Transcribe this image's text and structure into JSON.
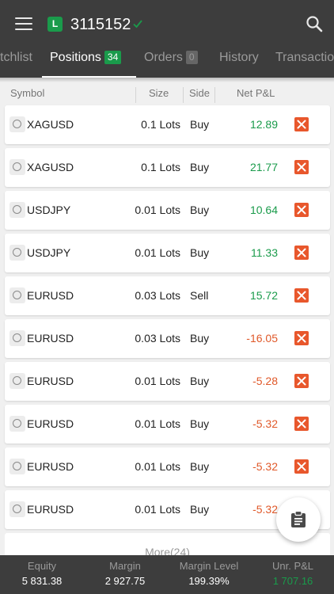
{
  "header": {
    "account_badge": "L",
    "account_number": "3115152"
  },
  "tabs": [
    {
      "label": "Watchlist",
      "visible_label": "tchlist"
    },
    {
      "label": "Positions",
      "count": "34"
    },
    {
      "label": "Orders",
      "count": "0"
    },
    {
      "label": "History"
    },
    {
      "label": "Transactions",
      "visible_label": "Transactio"
    }
  ],
  "columns": {
    "symbol": "Symbol",
    "size": "Size",
    "side": "Side",
    "pnl": "Net P&L"
  },
  "positions": [
    {
      "symbol": "XAGUSD",
      "size": "0.1 Lots",
      "side": "Buy",
      "pnl": "12.89",
      "pnl_sign": "pos"
    },
    {
      "symbol": "XAGUSD",
      "size": "0.1 Lots",
      "side": "Buy",
      "pnl": "21.77",
      "pnl_sign": "pos"
    },
    {
      "symbol": "USDJPY",
      "size": "0.01 Lots",
      "side": "Buy",
      "pnl": "10.64",
      "pnl_sign": "pos"
    },
    {
      "symbol": "USDJPY",
      "size": "0.01 Lots",
      "side": "Buy",
      "pnl": "11.33",
      "pnl_sign": "pos"
    },
    {
      "symbol": "EURUSD",
      "size": "0.03 Lots",
      "side": "Sell",
      "pnl": "15.72",
      "pnl_sign": "pos"
    },
    {
      "symbol": "EURUSD",
      "size": "0.03 Lots",
      "side": "Buy",
      "pnl": "-16.05",
      "pnl_sign": "neg"
    },
    {
      "symbol": "EURUSD",
      "size": "0.01 Lots",
      "side": "Buy",
      "pnl": "-5.28",
      "pnl_sign": "neg"
    },
    {
      "symbol": "EURUSD",
      "size": "0.01 Lots",
      "side": "Buy",
      "pnl": "-5.32",
      "pnl_sign": "neg"
    },
    {
      "symbol": "EURUSD",
      "size": "0.01 Lots",
      "side": "Buy",
      "pnl": "-5.32",
      "pnl_sign": "neg"
    },
    {
      "symbol": "EURUSD",
      "size": "0.01 Lots",
      "side": "Buy",
      "pnl": "-5.32",
      "pnl_sign": "neg"
    }
  ],
  "more_label": "More(24)",
  "footer": {
    "equity_label": "Equity",
    "equity_value": "5 831.38",
    "margin_label": "Margin",
    "margin_value": "2 927.75",
    "margin_level_label": "Margin Level",
    "margin_level_value": "199.39%",
    "upnl_label": "Unr. P&L",
    "upnl_value": "1 707.16"
  },
  "icons": {
    "menu": "hamburger-menu-icon",
    "verified": "checkmark-icon",
    "search": "search-icon",
    "close_position": "close-x-icon",
    "fab": "clipboard-icon"
  },
  "colors": {
    "header_bg": "#3d3d3d",
    "accent_green": "#1a9b4b",
    "loss_orange": "#e0592a",
    "close_button": "#e8572c"
  }
}
